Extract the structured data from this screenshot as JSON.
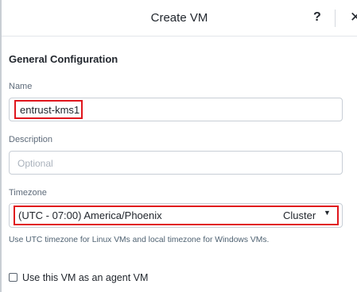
{
  "dialog": {
    "title": "Create VM",
    "help_glyph": "?",
    "close_glyph": "✕"
  },
  "general": {
    "section_title": "General Configuration",
    "name": {
      "label": "Name",
      "value": "entrust-kms1"
    },
    "description": {
      "label": "Description",
      "placeholder": "Optional",
      "value": ""
    },
    "timezone": {
      "label": "Timezone",
      "value": "(UTC - 07:00) America/Phoenix",
      "scope": "Cluster",
      "help": "Use UTC timezone for Linux VMs and local timezone for Windows VMs."
    },
    "agent_vm": {
      "label": "Use this VM as an agent VM",
      "checked": false
    }
  },
  "colors": {
    "highlight": "#e0161d",
    "label": "#5e6b7a",
    "border": "#c8ced6"
  }
}
